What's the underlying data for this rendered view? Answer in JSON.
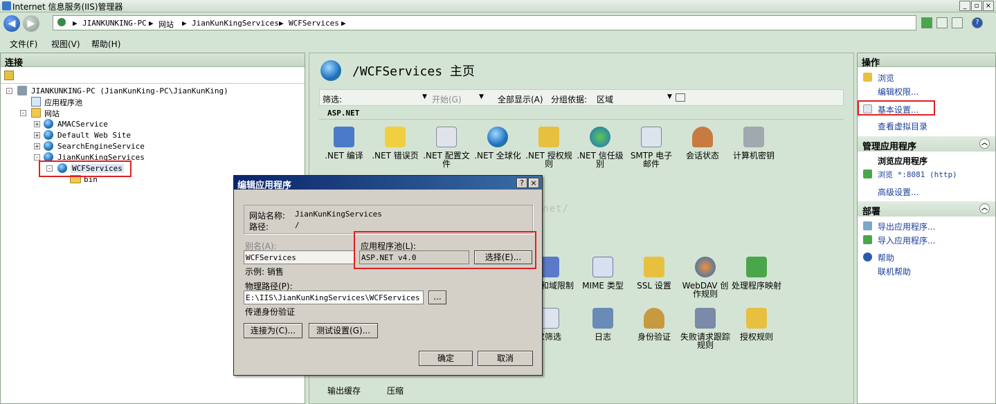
{
  "window": {
    "title": "Internet 信息服务(IIS)管理器",
    "btn_min": "_",
    "btn_restore": "▫",
    "btn_close": "×"
  },
  "address": {
    "crumbs": [
      "JIANKUNKING-PC",
      "网站",
      "JianKunKingServices",
      "WCFServices"
    ],
    "sep": "▶"
  },
  "menu": {
    "file": "文件(F)",
    "view": "视图(V)",
    "help": "帮助(H)"
  },
  "left": {
    "header": "连接",
    "tree": {
      "server": "JIANKUNKING-PC (JianKunKing-PC\\JianKunKing)",
      "app_pools": "应用程序池",
      "sites": "网站",
      "site1": "AMACService",
      "site2": "Default Web Site",
      "site3": "SearchEngineService",
      "site4": "JianKunKingServices",
      "app": "WCFServices",
      "bin": "bin"
    }
  },
  "center": {
    "title": "/WCFServices 主页",
    "filter_label": "筛选:",
    "start": "开始(G)",
    "show_all": "全部显示(A)",
    "group_by": "分组依据:",
    "group_value": "区域",
    "group_name": "ASP.NET",
    "features_row1": [
      ".NET 编译",
      ".NET 错误页",
      ".NET 配置文件",
      ".NET 全球化",
      ".NET 授权规则",
      ".NET 信任级别",
      "SMTP 电子邮件",
      "会话状态",
      "计算机密钥"
    ],
    "features_row2": [
      "地址和域限制",
      "MIME 类型",
      "SSL 设置",
      "WebDAV 创作规则",
      "处理程序映射"
    ],
    "features_row3": [
      "求筛选",
      "日志",
      "身份验证",
      "失败请求跟踪规则",
      "授权规则"
    ],
    "features_row4": [
      "输出缓存",
      "压缩"
    ],
    "watermark": "http://blog.csdn.net/"
  },
  "right": {
    "header": "操作",
    "browse": "浏览",
    "edit_perm": "编辑权限...",
    "basic_settings": "基本设置...",
    "view_vdirs": "查看虚拟目录",
    "manage_app_head": "管理应用程序",
    "browse_app": "浏览应用程序",
    "browse_port": "浏览 *:8081 (http)",
    "advanced": "高级设置...",
    "deploy_head": "部署",
    "export_app": "导出应用程序...",
    "import_app": "导入应用程序...",
    "help": "帮助",
    "online_help": "联机帮助"
  },
  "dialog": {
    "title": "编辑应用程序",
    "help_btn": "?",
    "close_btn": "×",
    "site_name_label": "网站名称:",
    "site_name_value": "JianKunKingServices",
    "path_label": "路径:",
    "path_value": "/",
    "alias_label": "别名(A):",
    "alias_value": "WCFServices",
    "example": "示例: 销售",
    "pool_label": "应用程序池(L):",
    "pool_value": "ASP.NET v4.0",
    "select_btn": "选择(E)...",
    "phys_label": "物理路径(P):",
    "phys_value": "E:\\IIS\\JianKunKingServices\\WCFServices",
    "browse_btn": "...",
    "auth": "传递身份验证",
    "connect_as": "连接为(C)...",
    "test_settings": "测试设置(G)...",
    "ok": "确定",
    "cancel": "取消"
  },
  "colors": {
    "highlight_box": "#e02020",
    "link": "#1a3e9a",
    "dialog_title": "#0a246a"
  }
}
